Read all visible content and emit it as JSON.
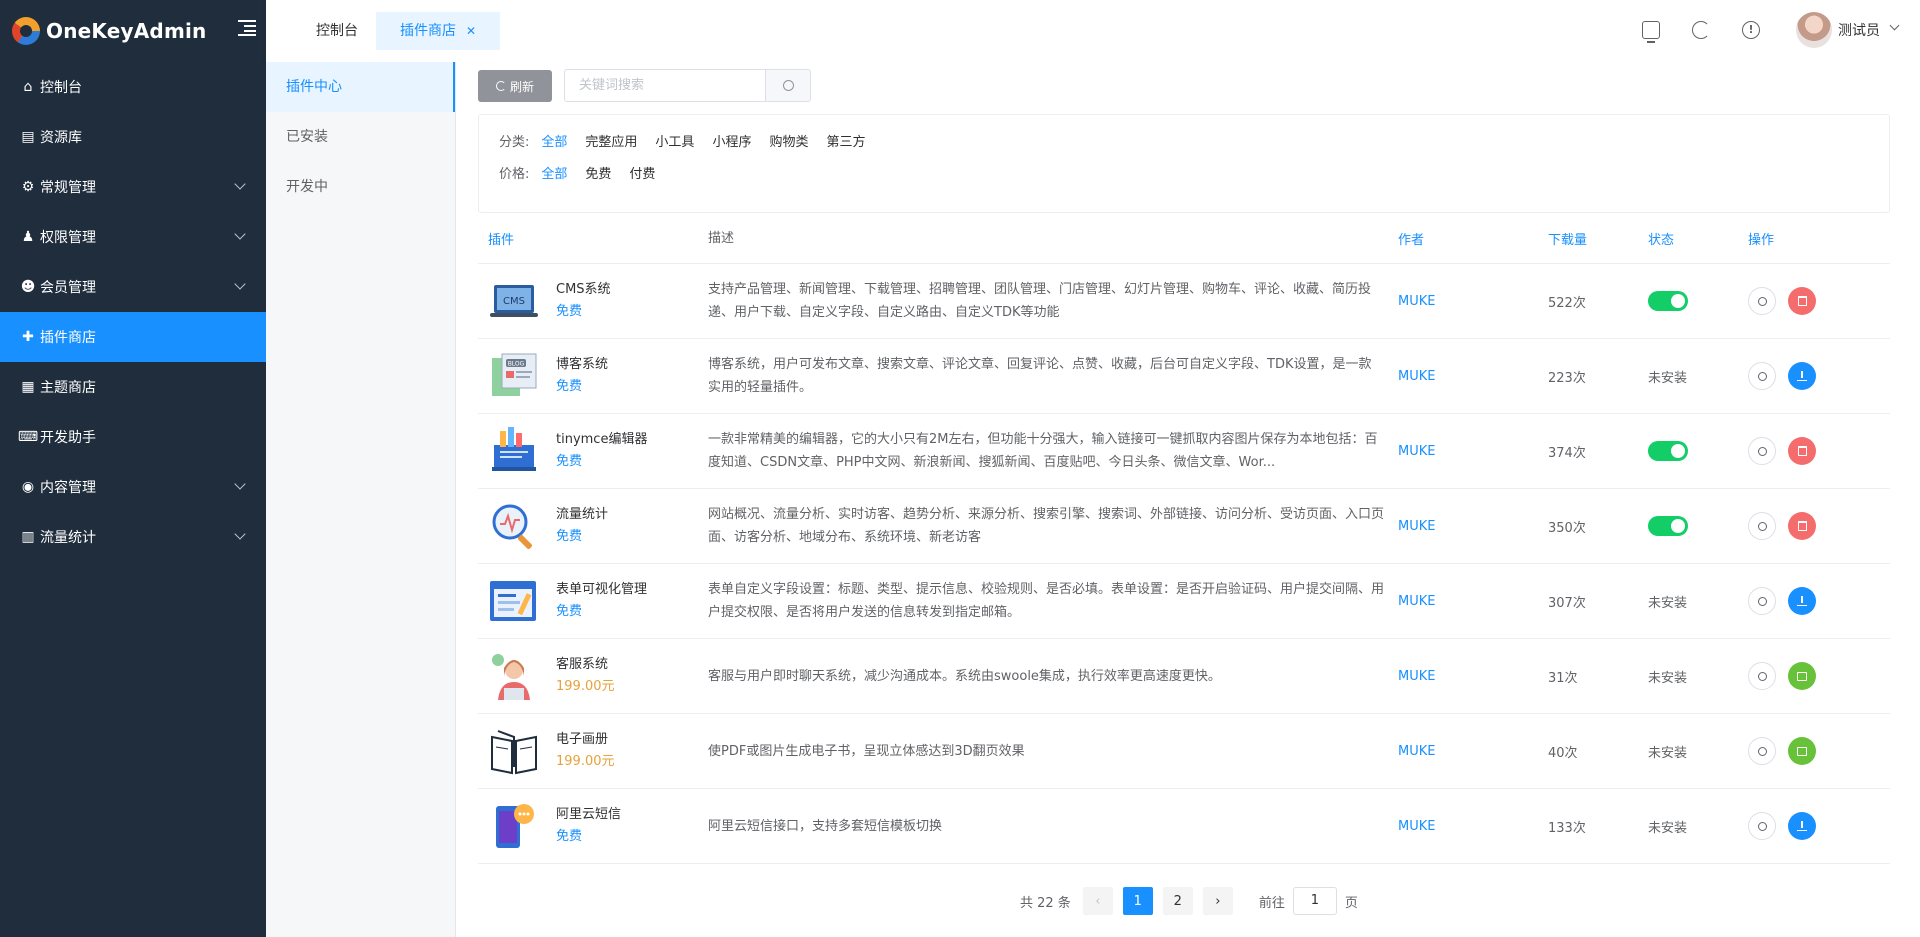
{
  "app": {
    "name": "OneKeyAdmin"
  },
  "sidebar": {
    "items": [
      {
        "label": "控制台",
        "icon": "home-icon",
        "has_children": false
      },
      {
        "label": "资源库",
        "icon": "database-icon",
        "has_children": false
      },
      {
        "label": "常规管理",
        "icon": "gear-icon",
        "has_children": true
      },
      {
        "label": "权限管理",
        "icon": "user-lock-icon",
        "has_children": true
      },
      {
        "label": "会员管理",
        "icon": "user-settings-icon",
        "has_children": true
      },
      {
        "label": "插件商店",
        "icon": "puzzle-icon",
        "has_children": false,
        "active": true
      },
      {
        "label": "主题商店",
        "icon": "layout-icon",
        "has_children": false
      },
      {
        "label": "开发助手",
        "icon": "code-icon",
        "has_children": false
      },
      {
        "label": "内容管理",
        "icon": "content-icon",
        "has_children": true
      },
      {
        "label": "流量统计",
        "icon": "bar-chart-icon",
        "has_children": true
      }
    ]
  },
  "tabs": [
    {
      "label": "控制台"
    },
    {
      "label": "插件商店",
      "active": true,
      "closable": true
    }
  ],
  "header": {
    "username": "测试员"
  },
  "subnav": {
    "items": [
      {
        "label": "插件中心",
        "active": true
      },
      {
        "label": "已安装"
      },
      {
        "label": "开发中"
      }
    ]
  },
  "toolbar": {
    "refresh_label": "刷新",
    "search_placeholder": "关键词搜索"
  },
  "filters": {
    "category": {
      "label": "分类:",
      "options": [
        "全部",
        "完整应用",
        "小工具",
        "小程序",
        "购物类",
        "第三方"
      ],
      "selected": "全部"
    },
    "price": {
      "label": "价格:",
      "options": [
        "全部",
        "免费",
        "付费"
      ],
      "selected": "全部"
    }
  },
  "table": {
    "columns": [
      "插件",
      "描述",
      "作者",
      "下载量",
      "状态",
      "操作"
    ],
    "rows": [
      {
        "name": "CMS系统",
        "price": "免费",
        "paid": false,
        "desc": "支持产品管理、新闻管理、下载管理、招聘管理、团队管理、门店管理、幻灯片管理、购物车、评论、收藏、简历投递、用户下载、自定义字段、自定义路由、自定义TDK等功能",
        "author": "MUKE",
        "downloads": "522次",
        "status": "enabled",
        "status_text": "",
        "action": "delete",
        "thumb": "cms"
      },
      {
        "name": "博客系统",
        "price": "免费",
        "paid": false,
        "desc": "博客系统，用户可发布文章、搜索文章、评论文章、回复评论、点赞、收藏，后台可自定义字段、TDK设置，是一款实用的轻量插件。",
        "author": "MUKE",
        "downloads": "223次",
        "status": "not_installed",
        "status_text": "未安装",
        "action": "install",
        "thumb": "blog"
      },
      {
        "name": "tinymce编辑器",
        "price": "免费",
        "paid": false,
        "desc": "一款非常精美的编辑器，它的大小只有2M左右，但功能十分强大，输入链接可一键抓取内容图片保存为本地包括：百度知道、CSDN文章、PHP中文网、新浪新闻、搜狐新闻、百度贴吧、今日头条、微信文章、Wor...",
        "author": "MUKE",
        "downloads": "374次",
        "status": "enabled",
        "status_text": "",
        "action": "delete",
        "thumb": "editor"
      },
      {
        "name": "流量统计",
        "price": "免费",
        "paid": false,
        "desc": "网站概况、流量分析、实时访客、趋势分析、来源分析、搜索引擎、搜索词、外部链接、访问分析、受访页面、入口页面、访客分析、地域分布、系统环境、新老访客",
        "author": "MUKE",
        "downloads": "350次",
        "status": "enabled",
        "status_text": "",
        "action": "delete",
        "thumb": "stats"
      },
      {
        "name": "表单可视化管理",
        "price": "免费",
        "paid": false,
        "desc": "表单自定义字段设置：标题、类型、提示信息、校验规则、是否必填。表单设置：是否开启验证码、用户提交间隔、用户提交权限、是否将用户发送的信息转发到指定邮箱。",
        "author": "MUKE",
        "downloads": "307次",
        "status": "not_installed",
        "status_text": "未安装",
        "action": "install",
        "thumb": "form"
      },
      {
        "name": "客服系统",
        "price": "199.00元",
        "paid": true,
        "desc": "客服与用户即时聊天系统，减少沟通成本。系统由swoole集成，执行效率更高速度更快。",
        "author": "MUKE",
        "downloads": "31次",
        "status": "not_installed",
        "status_text": "未安装",
        "action": "buy",
        "thumb": "service"
      },
      {
        "name": "电子画册",
        "price": "199.00元",
        "paid": true,
        "desc": "使PDF或图片生成电子书，呈现立体感达到3D翻页效果",
        "author": "MUKE",
        "downloads": "40次",
        "status": "not_installed",
        "status_text": "未安装",
        "action": "buy",
        "thumb": "book"
      },
      {
        "name": "阿里云短信",
        "price": "免费",
        "paid": false,
        "desc": "阿里云短信接口，支持多套短信模板切换",
        "author": "MUKE",
        "downloads": "133次",
        "status": "not_installed",
        "status_text": "未安装",
        "action": "install",
        "thumb": "sms"
      }
    ]
  },
  "pagination": {
    "total_text": "共 22 条",
    "pages": [
      "1",
      "2"
    ],
    "current": "1",
    "goto_label": "前往",
    "goto_value": "1",
    "page_suffix": "页"
  },
  "colors": {
    "sidebar_bg": "#1f2d3d",
    "accent": "#1890ff",
    "toggle_on": "#13ce66",
    "delete": "#f56c6c",
    "buy": "#67c23a",
    "price_paid": "#e6a23c"
  }
}
